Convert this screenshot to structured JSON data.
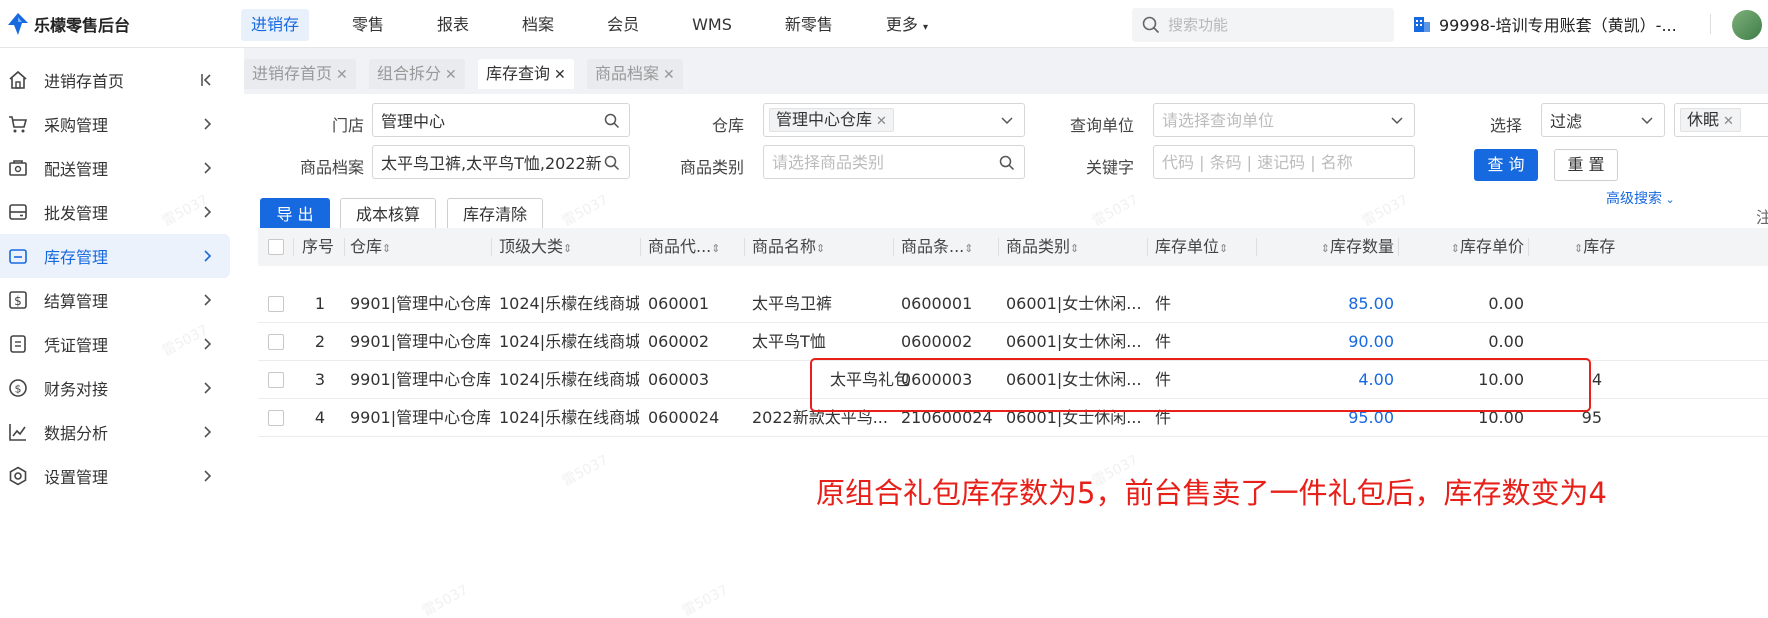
{
  "app": {
    "title": "乐檬零售后台"
  },
  "topnav": [
    "进销存",
    "零售",
    "报表",
    "档案",
    "会员",
    "WMS",
    "新零售",
    "更多"
  ],
  "search": {
    "placeholder": "搜索功能"
  },
  "account": {
    "label": "99998-培训专用账套（黄凯）-..."
  },
  "sidebar": {
    "items": [
      {
        "label": "进销存首页",
        "icon": "home-icon"
      },
      {
        "label": "采购管理",
        "icon": "cart-icon"
      },
      {
        "label": "配送管理",
        "icon": "delivery-icon"
      },
      {
        "label": "批发管理",
        "icon": "wholesale-icon"
      },
      {
        "label": "库存管理",
        "icon": "inventory-icon"
      },
      {
        "label": "结算管理",
        "icon": "settlement-icon"
      },
      {
        "label": "凭证管理",
        "icon": "voucher-icon"
      },
      {
        "label": "财务对接",
        "icon": "finance-icon"
      },
      {
        "label": "数据分析",
        "icon": "chart-icon"
      },
      {
        "label": "设置管理",
        "icon": "settings-icon"
      }
    ],
    "active_index": 4
  },
  "tabs": [
    {
      "label": "进销存首页",
      "active": false
    },
    {
      "label": "组合拆分",
      "active": false
    },
    {
      "label": "库存查询",
      "active": true
    },
    {
      "label": "商品档案",
      "active": false
    }
  ],
  "filters": {
    "store_label": "门店",
    "store_value": "管理中心",
    "warehouse_label": "仓库",
    "warehouse_tag": "管理中心仓库",
    "unit_label": "查询单位",
    "unit_placeholder": "请选择查询单位",
    "select_label": "选择",
    "select_value": "过滤",
    "select_tag": "休眠",
    "product_label": "商品档案",
    "product_value": "太平鸟卫裤,太平鸟T恤,2022新",
    "category_label": "商品类别",
    "category_placeholder": "请选择商品类别",
    "keyword_label": "关键字",
    "keyword_placeholder": "代码 | 条码 | 速记码 | 名称"
  },
  "buttons": {
    "query": "查 询",
    "reset": "重 置",
    "advanced": "高级搜索",
    "export": "导 出",
    "cost": "成本核算",
    "clear": "库存清除"
  },
  "table": {
    "headers": [
      "序号",
      "仓库",
      "顶级大类",
      "商品代...",
      "商品名称",
      "商品条...",
      "商品类别",
      "库存单位",
      "库存数量",
      "库存单价",
      "库存"
    ],
    "rows": [
      [
        "1",
        "9901|管理中心仓库",
        "1024|乐檬在线商城",
        "060001",
        "太平鸟卫裤",
        "0600001",
        "06001|女士休闲...",
        "件",
        "85.00",
        "0.00",
        ""
      ],
      [
        "2",
        "9901|管理中心仓库",
        "1024|乐檬在线商城",
        "060002",
        "太平鸟T恤",
        "0600002",
        "06001|女士休闲...",
        "件",
        "90.00",
        "0.00",
        ""
      ],
      [
        "3",
        "9901|管理中心仓库",
        "1024|乐檬在线商城",
        "060003",
        "太平鸟礼包",
        "0600003",
        "06001|女士休闲...",
        "件",
        "4.00",
        "10.00",
        "4"
      ],
      [
        "4",
        "9901|管理中心仓库",
        "1024|乐檬在线商城",
        "0600024",
        "2022新款太平鸟...",
        "210600024",
        "06001|女士休闲...",
        "件",
        "95.00",
        "10.00",
        "95"
      ]
    ]
  },
  "annotation": {
    "text": "原组合礼包库存数为5，前台售卖了一件礼包后，库存数变为4",
    "color": "#e8201a"
  },
  "note_fragment": "注",
  "watermark": "雷5037",
  "colors": {
    "primary": "#1769e0",
    "highlight": "#e8201a"
  }
}
